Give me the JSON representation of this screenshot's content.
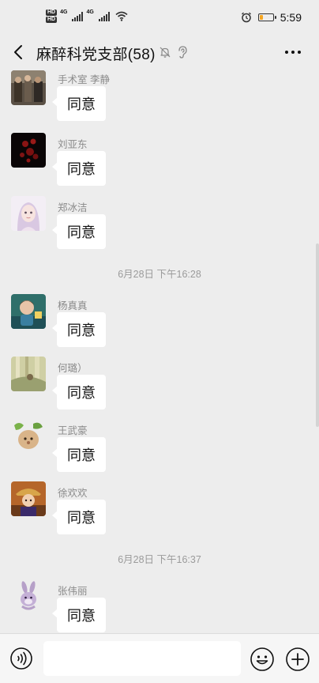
{
  "status_bar": {
    "hd_badge_1": "HD",
    "hd_badge_2": "HD",
    "network_1": "4G",
    "network_2": "4G",
    "time": "5:59",
    "battery_level": 0.25,
    "battery_color": "#f5a623"
  },
  "header": {
    "title": "麻醉科党支部(58)",
    "back_icon": "chevron-left-icon",
    "mute_icon": "bell-off-icon",
    "ear_icon": "ear-icon",
    "more_icon": "more-dots-icon"
  },
  "messages": [
    {
      "sender": "手术室 李静",
      "text": "同意"
    },
    {
      "sender": "刘亚东",
      "text": "同意"
    },
    {
      "sender": "郑冰洁",
      "text": "同意"
    },
    {
      "sender": "杨真真",
      "text": "同意"
    },
    {
      "sender": "何璐）",
      "text": "同意"
    },
    {
      "sender": "王武豪",
      "text": "同意"
    },
    {
      "sender": "徐欢欢",
      "text": "同意"
    },
    {
      "sender": "张伟丽",
      "text": "同意"
    }
  ],
  "time_separators": [
    {
      "label": "6月28日 下午16:28"
    },
    {
      "label": "6月28日 下午16:37"
    }
  ],
  "input_bar": {
    "placeholder": "",
    "voice_icon": "voice-icon",
    "emoji_icon": "emoji-icon",
    "plus_icon": "plus-icon"
  }
}
